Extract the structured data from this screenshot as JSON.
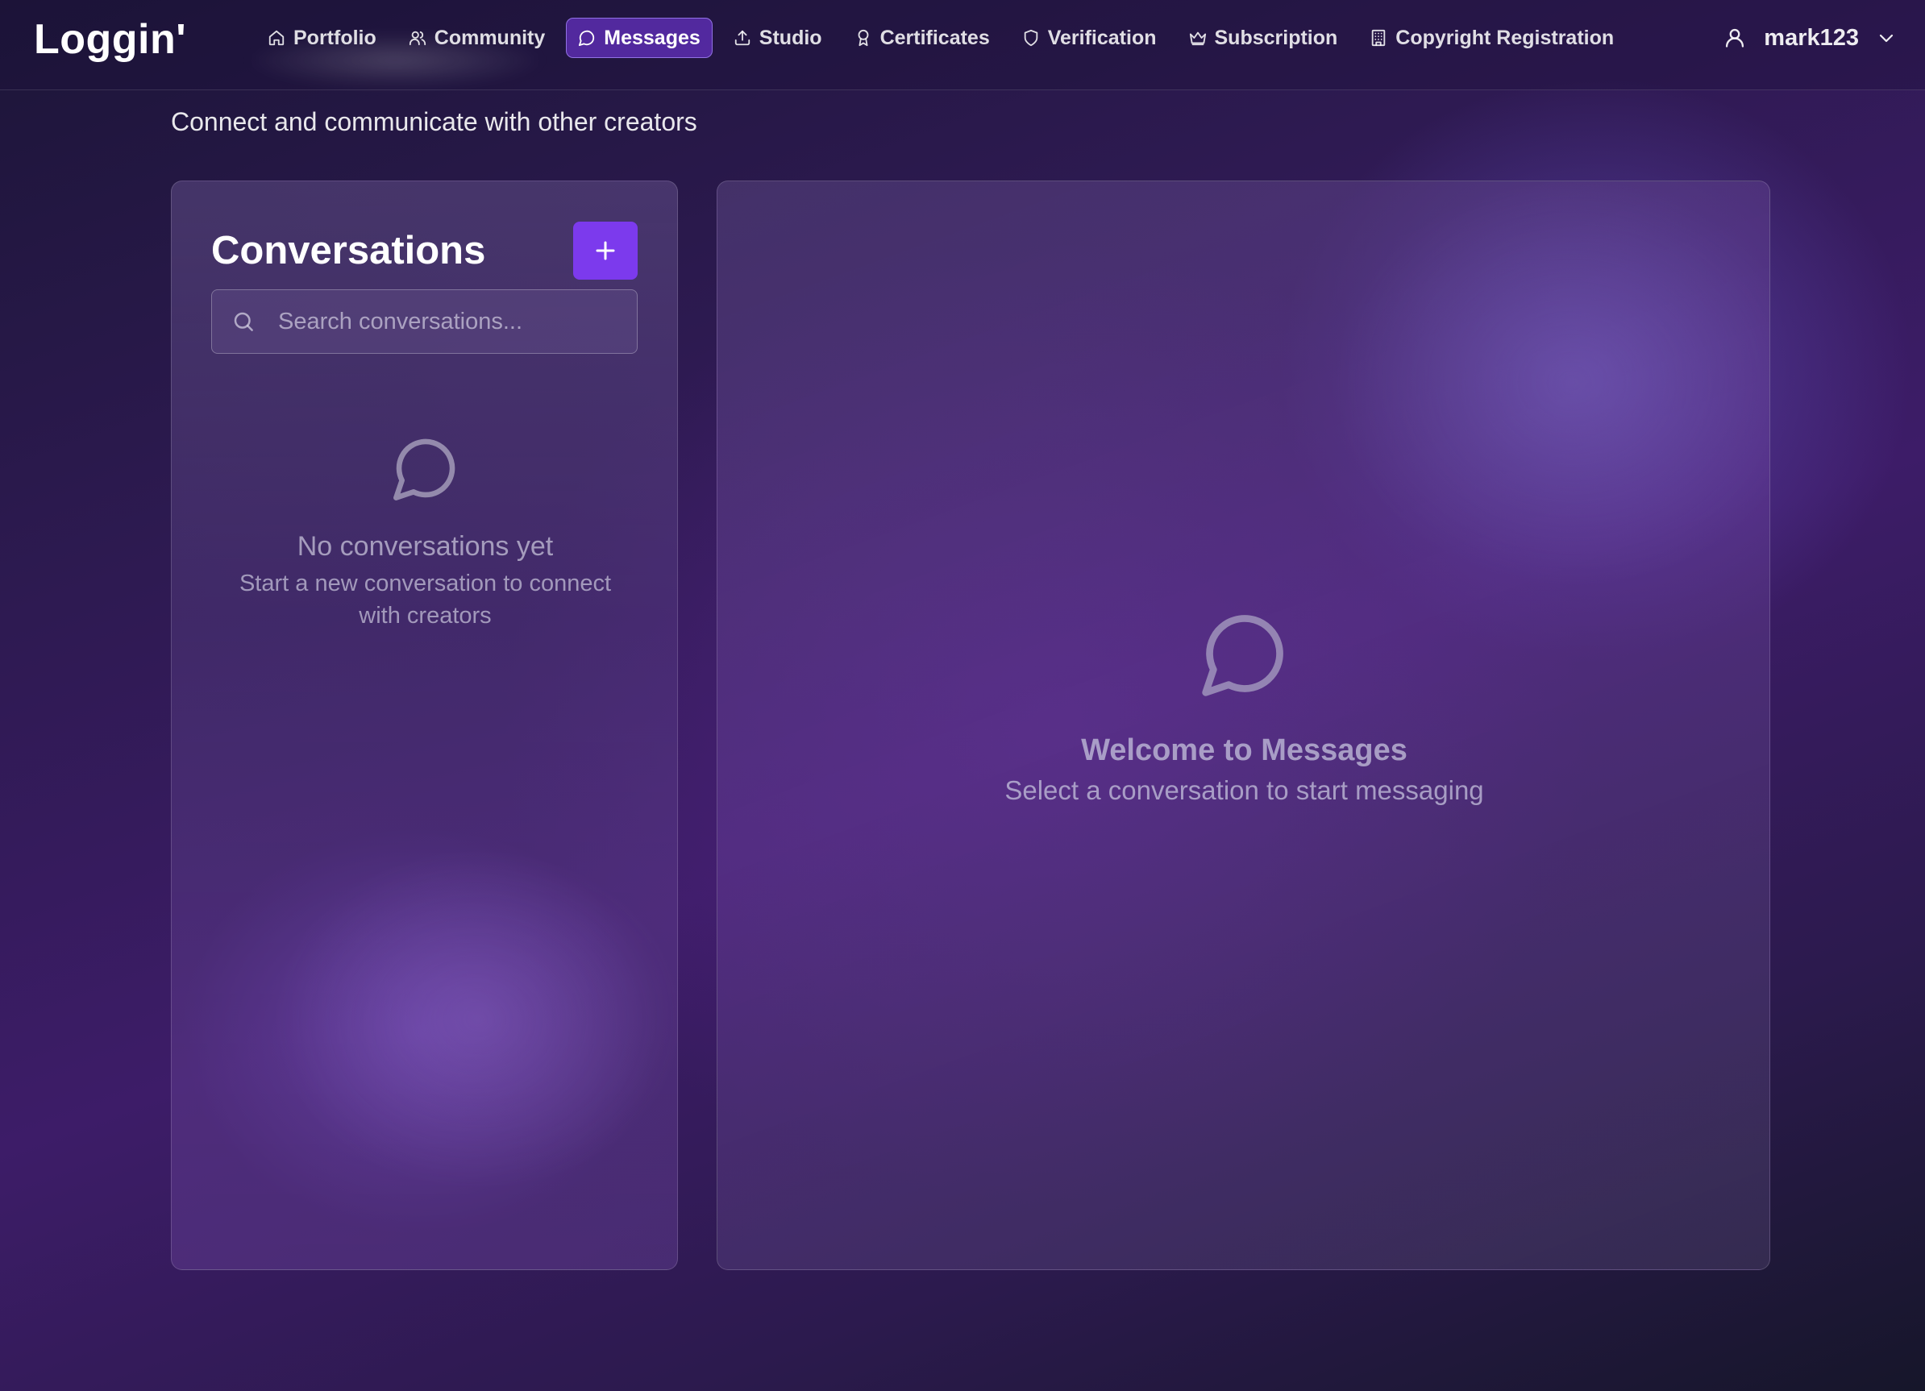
{
  "app": {
    "logo": "Loggin'"
  },
  "nav": {
    "items": [
      {
        "label": "Portfolio",
        "icon": "home-icon",
        "active": false
      },
      {
        "label": "Community",
        "icon": "users-icon",
        "active": false
      },
      {
        "label": "Messages",
        "icon": "message-circle-icon",
        "active": true
      },
      {
        "label": "Studio",
        "icon": "upload-icon",
        "active": false
      },
      {
        "label": "Certificates",
        "icon": "award-icon",
        "active": false
      },
      {
        "label": "Verification",
        "icon": "shield-icon",
        "active": false
      },
      {
        "label": "Subscription",
        "icon": "crown-icon",
        "active": false
      },
      {
        "label": "Copyright Registration",
        "icon": "building-icon",
        "active": false
      }
    ]
  },
  "user": {
    "username": "mark123",
    "icon": "user-icon",
    "menu_icon": "chevron-down-icon"
  },
  "page": {
    "subtitle": "Connect and communicate with other creators"
  },
  "conversations": {
    "title": "Conversations",
    "add_label": "+",
    "search_placeholder": "Search conversations...",
    "search_value": "",
    "empty_title": "No conversations yet",
    "empty_subtitle": "Start a new conversation to connect with creators"
  },
  "chat": {
    "welcome_title": "Welcome to Messages",
    "welcome_subtitle": "Select a conversation to start messaging"
  },
  "colors": {
    "accent": "#7c3aed",
    "active_nav_border": "#a78bfa",
    "muted_text": "#bebad2"
  }
}
